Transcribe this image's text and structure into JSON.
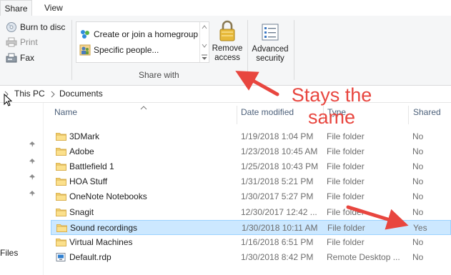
{
  "ribbon": {
    "tabs": [
      "Share",
      "View"
    ],
    "send": {
      "burn_label": "Burn to disc",
      "print_label": "Print",
      "fax_label": "Fax"
    },
    "share_with": {
      "gallery": [
        "Create or join a homegroup",
        "Specific people..."
      ],
      "group_label": "Share with",
      "remove_access_line1": "Remove",
      "remove_access_line2": "access",
      "advanced_line1": "Advanced",
      "advanced_line2": "security"
    }
  },
  "address": {
    "crumbs": [
      "This PC",
      "Documents"
    ]
  },
  "columns": {
    "name": "Name",
    "date": "Date modified",
    "type": "Type",
    "shared": "Shared"
  },
  "files": [
    {
      "name": "3DMark",
      "date": "1/19/2018 1:04 PM",
      "type": "File folder",
      "shared": "No"
    },
    {
      "name": "Adobe",
      "date": "1/23/2018 10:45 AM",
      "type": "File folder",
      "shared": "No"
    },
    {
      "name": "Battlefield 1",
      "date": "1/25/2018 10:43 PM",
      "type": "File folder",
      "shared": "No"
    },
    {
      "name": "HOA Stuff",
      "date": "1/31/2018 5:21 PM",
      "type": "File folder",
      "shared": "No"
    },
    {
      "name": "OneNote Notebooks",
      "date": "1/30/2017 5:27 PM",
      "type": "File folder",
      "shared": "No"
    },
    {
      "name": "Snagit",
      "date": "12/30/2017 12:42 ...",
      "type": "File folder",
      "shared": "No"
    },
    {
      "name": "Sound recordings",
      "date": "1/30/2018 10:11 AM",
      "type": "File folder",
      "shared": "Yes"
    },
    {
      "name": "Virtual Machines",
      "date": "1/16/2018 6:51 PM",
      "type": "File folder",
      "shared": "No"
    },
    {
      "name": "Default.rdp",
      "date": "1/30/2018 8:42 PM",
      "type": "Remote Desktop ...",
      "shared": "No"
    }
  ],
  "nav": {
    "files_label": "Files"
  },
  "annotation": {
    "line1": "Stays the",
    "line2": "same",
    "color": "#e8463f"
  },
  "colors": {
    "selection": "#cce8ff",
    "selection_border": "#99d1ff",
    "folder": "#f8d775"
  },
  "icons": [
    "burn-disc-icon",
    "print-icon",
    "fax-icon",
    "homegroup-icon",
    "people-icon",
    "lock-icon",
    "security-icon",
    "folder-icon",
    "rdp-file-icon",
    "pin-icon",
    "sort-up-icon"
  ]
}
